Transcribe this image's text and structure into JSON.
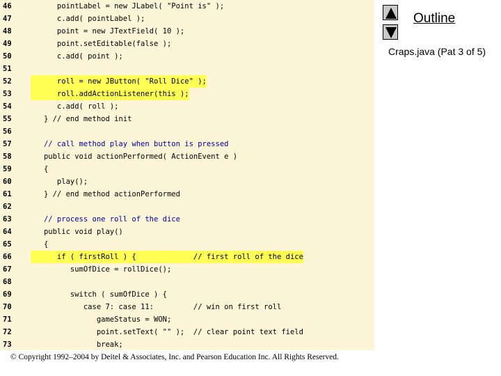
{
  "sidebar": {
    "outline_title": "Outline",
    "subtitle": "Craps.java (Pat 3 of 5)",
    "prev_icon": "triangle-up-icon",
    "next_icon": "triangle-down-icon"
  },
  "footer": {
    "copyright": "© Copyright 1992–2004 by Deitel & Associates, Inc. and Pearson Education Inc. All Rights Reserved."
  },
  "code": {
    "lines": [
      {
        "num": "46",
        "text": "      pointLabel = new JLabel( \"Point is\" );"
      },
      {
        "num": "47",
        "text": "      c.add( pointLabel );"
      },
      {
        "num": "48",
        "text": "      point = new JTextField( 10 );"
      },
      {
        "num": "49",
        "text": "      point.setEditable(false );"
      },
      {
        "num": "50",
        "text": "      c.add( point );"
      },
      {
        "num": "51",
        "text": ""
      },
      {
        "num": "52",
        "text": "      roll = new JButton( \"Roll Dice\" );"
      },
      {
        "num": "53",
        "text": "      roll.addActionListener(this );"
      },
      {
        "num": "54",
        "text": "      c.add( roll );"
      },
      {
        "num": "55",
        "text": "   } // end method init"
      },
      {
        "num": "56",
        "text": ""
      },
      {
        "num": "57",
        "text": "   // call method play when button is pressed"
      },
      {
        "num": "58",
        "text": "   public void actionPerformed( ActionEvent e )"
      },
      {
        "num": "59",
        "text": "   {"
      },
      {
        "num": "60",
        "text": "      play();"
      },
      {
        "num": "61",
        "text": "   } // end method actionPerformed"
      },
      {
        "num": "62",
        "text": ""
      },
      {
        "num": "63",
        "text": "   // process one roll of the dice"
      },
      {
        "num": "64",
        "text": "   public void play()"
      },
      {
        "num": "65",
        "text": "   {"
      },
      {
        "num": "66",
        "text": "      if ( firstRoll ) {             // first roll of the dice"
      },
      {
        "num": "67",
        "text": "         sumOfDice = rollDice();"
      },
      {
        "num": "68",
        "text": ""
      },
      {
        "num": "69",
        "text": "         switch ( sumOfDice ) {"
      },
      {
        "num": "70",
        "text": "            case 7: case 11:         // win on first roll"
      },
      {
        "num": "71",
        "text": "               gameStatus = WON;"
      },
      {
        "num": "72",
        "text": "               point.setText( \"\" );  // clear point text field"
      },
      {
        "num": "73",
        "text": "               break;"
      }
    ]
  },
  "colors": {
    "code_background": "#fdf5d8",
    "highlight": "#ffff55",
    "keyword": "#0000cc",
    "comment": "#000099",
    "string": "#006600"
  }
}
